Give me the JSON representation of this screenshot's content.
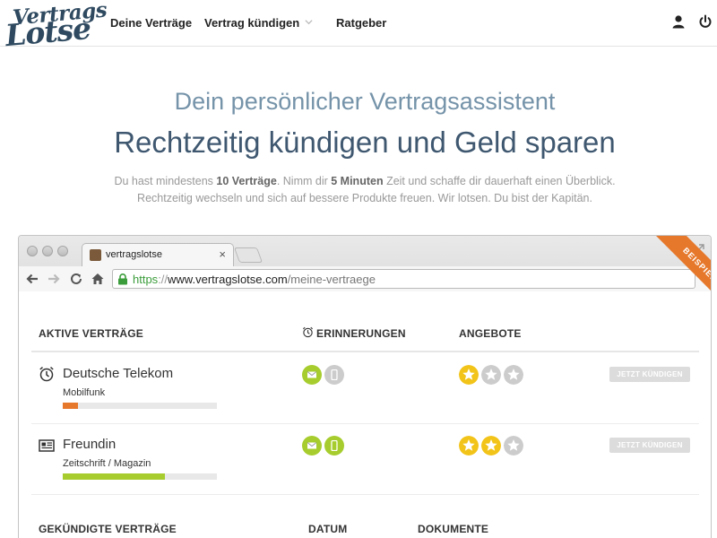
{
  "brand": {
    "logo_line1": "Vertrags",
    "logo_line2": "Lotse"
  },
  "nav": {
    "items": [
      {
        "label": "Deine Verträge"
      },
      {
        "label": "Vertrag kündigen"
      },
      {
        "label": "Ratgeber"
      }
    ],
    "icons": [
      "user-icon",
      "power-icon"
    ]
  },
  "hero": {
    "subtitle": "Dein persönlicher Vertragsassistent",
    "title": "Rechtzeitig kündigen und Geld sparen",
    "desc": {
      "p1": "Du hast mindestens ",
      "b1": "10 Verträge",
      "p2": ". Nimm dir ",
      "b2": "5 Minuten",
      "p3": " Zeit und schaffe dir dauerhaft einen Überblick.",
      "line2": "Rechtzeitig wechseln und sich auf bessere Produkte freuen. Wir lotsen. Du bist der Kapitän."
    }
  },
  "browser": {
    "tab_title": "vertragslotse",
    "tab_close": "×",
    "url": {
      "scheme": "https",
      "sep": "://",
      "domain": "www.vertragslotse.com",
      "path": "/meine-vertraege"
    },
    "ribbon": "BEISPIEL"
  },
  "active": {
    "headers": {
      "contracts": "AKTIVE VERTRÄGE",
      "reminders": "ERINNERUNGEN",
      "offers": "ANGEBOTE"
    },
    "rows": [
      {
        "name": "Deutsche Telekom",
        "category": "Mobilfunk",
        "icon": "alarm-clock-icon",
        "progress": 0.1,
        "progress_color": "#e6782b",
        "reminders": [
          {
            "type": "mail",
            "active": true
          },
          {
            "type": "phone",
            "active": false
          }
        ],
        "stars": 1,
        "button": "JETZT KÜNDIGEN"
      },
      {
        "name": "Freundin",
        "category": "Zeitschrift / Magazin",
        "icon": "newspaper-icon",
        "progress": 0.66,
        "progress_color": "#a6cd2d",
        "reminders": [
          {
            "type": "mail",
            "active": true
          },
          {
            "type": "phone",
            "active": true
          }
        ],
        "stars": 2,
        "button": "JETZT KÜNDIGEN"
      }
    ]
  },
  "cancelled": {
    "headers": {
      "contracts": "GEKÜNDIGTE VERTRÄGE",
      "date": "DATUM",
      "docs": "DOKUMENTE"
    }
  },
  "colors": {
    "brand_navy": "#2f4a60",
    "accent_orange": "#e6782b",
    "active_green": "#a6cd2d",
    "star_yellow": "#f2c318",
    "inactive_grey": "#cccccc"
  }
}
